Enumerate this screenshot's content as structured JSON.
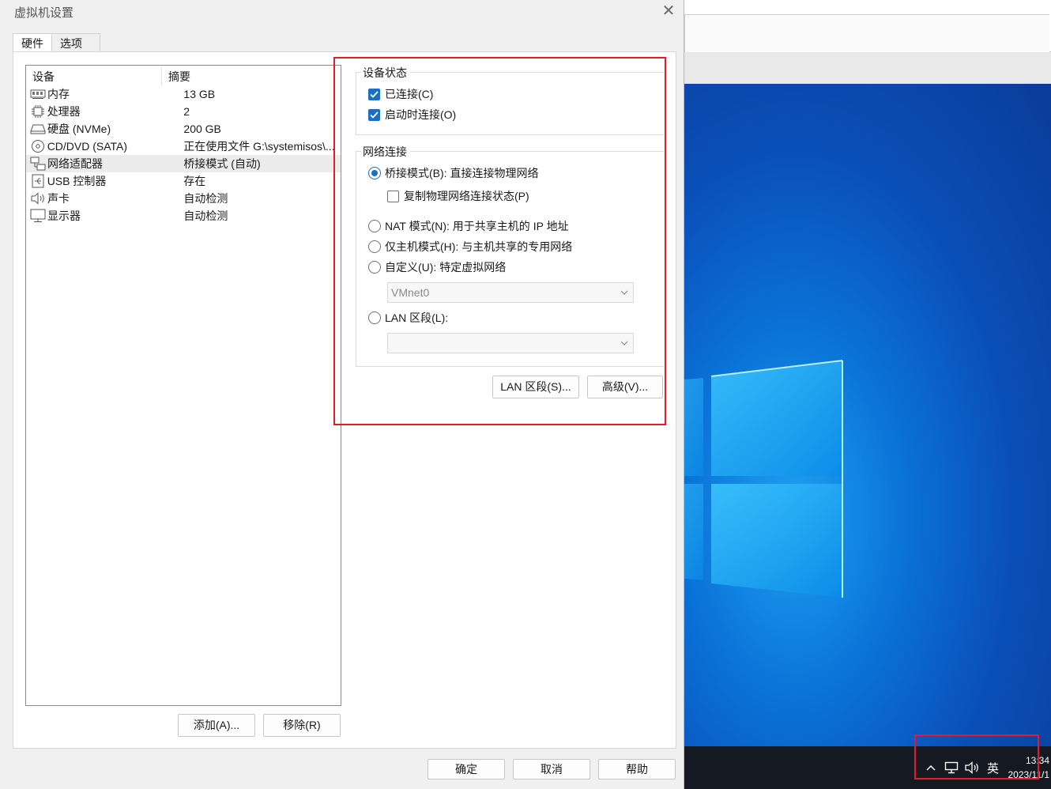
{
  "dialog": {
    "title": "虚拟机设置",
    "tabs": [
      {
        "label": "硬件"
      },
      {
        "label": "选项"
      }
    ],
    "device_list": {
      "col_device": "设备",
      "col_summary": "摘要",
      "rows": [
        {
          "name": "内存",
          "summary": "13 GB",
          "icon": "memory-icon"
        },
        {
          "name": "处理器",
          "summary": "2",
          "icon": "processor-icon"
        },
        {
          "name": "硬盘 (NVMe)",
          "summary": "200 GB",
          "icon": "hard-disk-icon"
        },
        {
          "name": "CD/DVD (SATA)",
          "summary": "正在使用文件 G:\\systemisos\\...",
          "icon": "cd-dvd-icon"
        },
        {
          "name": "网络适配器",
          "summary": "桥接模式 (自动)",
          "icon": "network-adapter-icon"
        },
        {
          "name": "USB 控制器",
          "summary": "存在",
          "icon": "usb-icon"
        },
        {
          "name": "声卡",
          "summary": "自动检测",
          "icon": "speaker-icon"
        },
        {
          "name": "显示器",
          "summary": "自动检测",
          "icon": "monitor-icon"
        }
      ],
      "selected_index": 4
    },
    "add_button": "添加(A)...",
    "remove_button": "移除(R)",
    "device_status": {
      "title": "设备状态",
      "connected": {
        "label": "已连接(C)",
        "checked": true
      },
      "connect_on_start": {
        "label": "启动时连接(O)",
        "checked": true
      }
    },
    "network": {
      "title": "网络连接",
      "bridged": {
        "label": "桥接模式(B): 直接连接物理网络",
        "selected": true
      },
      "replicate": {
        "label": "复制物理网络连接状态(P)",
        "checked": false
      },
      "nat": {
        "label": "NAT 模式(N): 用于共享主机的 IP 地址",
        "selected": false
      },
      "host_only": {
        "label": "仅主机模式(H): 与主机共享的专用网络",
        "selected": false
      },
      "custom": {
        "label": "自定义(U): 特定虚拟网络",
        "selected": false
      },
      "custom_select_value": "VMnet0",
      "lan_segment": {
        "label": "LAN 区段(L):",
        "selected": false
      },
      "lan_select_value": ""
    },
    "lan_segments_button": "LAN 区段(S)...",
    "advanced_button": "高级(V)...",
    "ok_button": "确定",
    "cancel_button": "取消",
    "help_button": "帮助"
  },
  "taskbar": {
    "ime": "英",
    "time": "13:34",
    "date": "2023/11/1"
  },
  "colors": {
    "accent": "#1a6fc4",
    "highlight_box": "#e8182d",
    "desktop_blue": "#0a5fd0"
  }
}
